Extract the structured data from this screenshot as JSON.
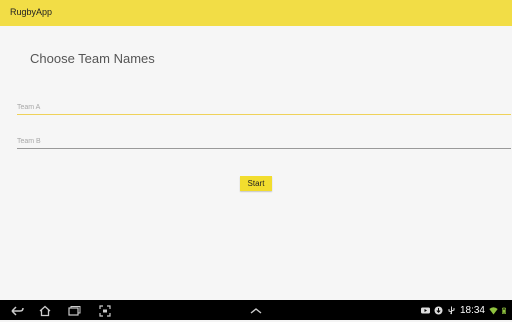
{
  "app": {
    "title": "RugbyApp"
  },
  "main": {
    "heading": "Choose Team Names",
    "team_a": {
      "placeholder": "Team A",
      "value": ""
    },
    "team_b": {
      "placeholder": "Team B",
      "value": ""
    },
    "start_label": "Start"
  },
  "system_bar": {
    "time": "18:34",
    "icons": [
      "back-icon",
      "home-icon",
      "recent-apps-icon",
      "screenshot-icon",
      "up-chevron-icon",
      "youtube-icon",
      "download-icon",
      "usb-icon",
      "wifi-icon",
      "battery-icon"
    ]
  },
  "colors": {
    "accent": "#f2dd46",
    "button": "#f2dd2e",
    "background": "#f6f6f6",
    "nav_bar": "#000000"
  }
}
